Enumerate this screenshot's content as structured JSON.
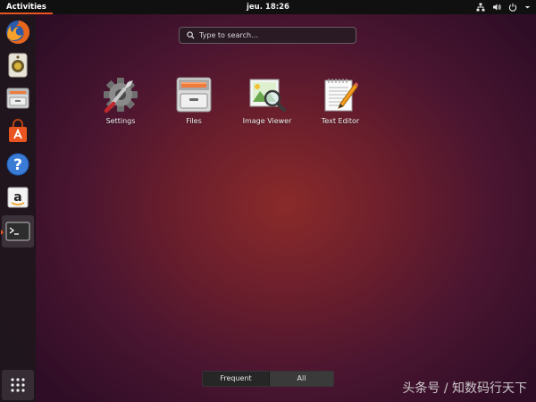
{
  "topbar": {
    "activities_label": "Activities",
    "clock": "jeu. 18:26",
    "status_icons": [
      "network-icon",
      "volume-icon",
      "power-icon",
      "chevron-down-icon"
    ]
  },
  "dock": {
    "items": [
      {
        "name": "firefox",
        "icon": "firefox-icon"
      },
      {
        "name": "rhythmbox",
        "icon": "speaker-icon"
      },
      {
        "name": "files",
        "icon": "file-cabinet-icon"
      },
      {
        "name": "software",
        "icon": "shopping-bag-icon"
      },
      {
        "name": "help",
        "icon": "help-icon"
      },
      {
        "name": "amazon",
        "icon": "amazon-icon"
      },
      {
        "name": "terminal",
        "icon": "terminal-icon",
        "active": true
      }
    ],
    "show_apps_icon": "grid-icon"
  },
  "search": {
    "placeholder": "Type to search…",
    "value": ""
  },
  "apps": [
    {
      "label": "Settings",
      "icon": "settings-gear-icon"
    },
    {
      "label": "Files",
      "icon": "file-cabinet-icon"
    },
    {
      "label": "Image Viewer",
      "icon": "image-viewer-icon"
    },
    {
      "label": "Text Editor",
      "icon": "text-editor-icon"
    }
  ],
  "view_tabs": {
    "frequent": "Frequent",
    "all": "All",
    "selected": "all"
  },
  "watermark": "头条号 / 知数码行天下",
  "colors": {
    "accent": "#e95420",
    "topbar": "#101010",
    "dock": "#1e161c"
  }
}
